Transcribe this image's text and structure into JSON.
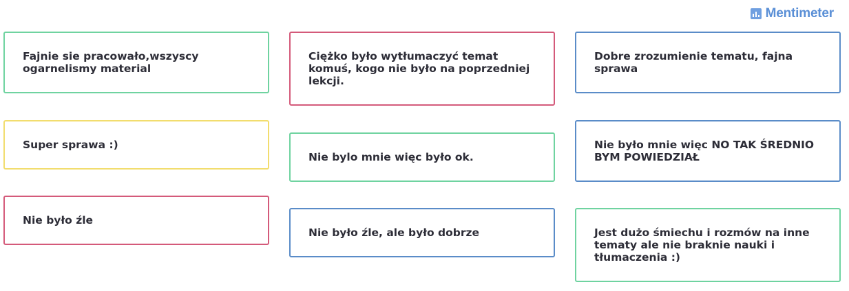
{
  "brand": {
    "name": "Mentimeter",
    "icon": "bar-chart-icon",
    "color": "#5a8fd6"
  },
  "colors": {
    "green": "#6fd3a0",
    "red": "#d45a7a",
    "blue": "#5a8cc8",
    "yellow": "#f2dd6e"
  },
  "responses": {
    "col1": [
      {
        "text": "Fajnie sie pracowało,wszyscy ogarnelismy material",
        "color": "green"
      },
      {
        "text": "Super sprawa :)",
        "color": "yellow"
      },
      {
        "text": "Nie było źle",
        "color": "red"
      }
    ],
    "col2": [
      {
        "text": "Ciężko było wytłumaczyć temat komuś, kogo nie było na poprzedniej lekcji.",
        "color": "red"
      },
      {
        "text": "Nie bylo mnie więc było ok.",
        "color": "green"
      },
      {
        "text": "Nie było źle, ale było dobrze",
        "color": "blue"
      }
    ],
    "col3": [
      {
        "text": "Dobre zrozumienie tematu, fajna sprawa",
        "color": "blue"
      },
      {
        "text": "Nie było mnie więc NO TAK ŚREDNIO BYM POWIEDZIAŁ",
        "color": "blue"
      },
      {
        "text": "Jest dużo śmiechu i rozmów na inne tematy ale nie braknie nauki i tłumaczenia :)",
        "color": "green"
      }
    ]
  }
}
